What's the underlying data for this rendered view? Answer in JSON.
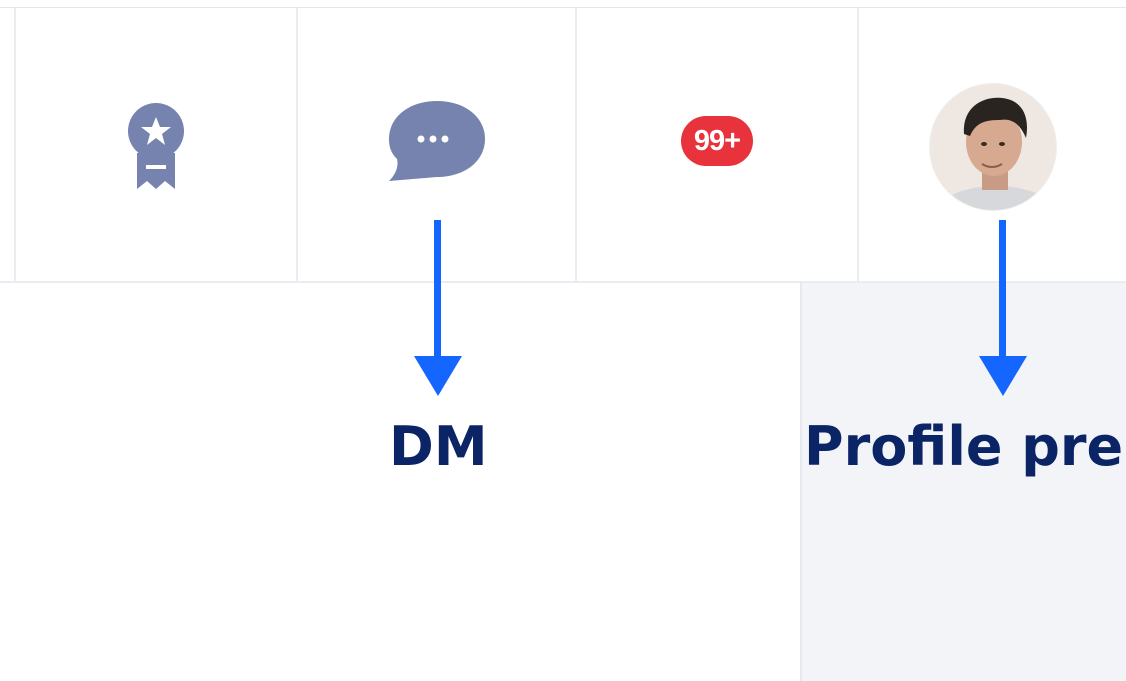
{
  "toolbar": {
    "items": [
      {
        "name": "achievements",
        "icon": "award-ribbon-icon"
      },
      {
        "name": "messages",
        "icon": "chat-bubble-icon"
      },
      {
        "name": "notifications",
        "icon": "notification-badge",
        "badge": "99+"
      },
      {
        "name": "profile",
        "icon": "avatar"
      }
    ]
  },
  "annotations": {
    "dm_label": "DM",
    "profile_label": "Profile pre"
  },
  "colors": {
    "icon": "#7683ae",
    "badge": "#e8323c",
    "arrow": "#1565ff",
    "label": "#0b2466",
    "panel": "#f2f4f7"
  }
}
